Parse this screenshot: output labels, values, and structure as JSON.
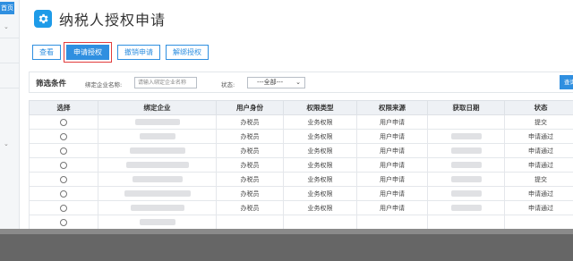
{
  "sidebar": {
    "active_label": "首页"
  },
  "header": {
    "title": "纳税人授权申请"
  },
  "toolbar": {
    "view": "查看",
    "apply": "申请授权",
    "revoke": "撤销申请",
    "unbind": "解绑授权"
  },
  "filter": {
    "title": "筛选条件",
    "company_label": "绑定企业名称:",
    "company_placeholder": "请输入绑定企业名称",
    "status_label": "状态:",
    "status_value": "---全部---",
    "search_label": "查询"
  },
  "table": {
    "columns": [
      "选择",
      "绑定企业",
      "用户身份",
      "权限类型",
      "权限来源",
      "获取日期",
      "状态"
    ],
    "rows": [
      {
        "role": "办税员",
        "perm_type": "业务权限",
        "source": "用户申请",
        "status": "提交"
      },
      {
        "role": "办税员",
        "perm_type": "业务权限",
        "source": "用户申请",
        "status": "申请通过"
      },
      {
        "role": "办税员",
        "perm_type": "业务权限",
        "source": "用户申请",
        "status": "申请通过"
      },
      {
        "role": "办税员",
        "perm_type": "业务权限",
        "source": "用户申请",
        "status": "申请通过"
      },
      {
        "role": "办税员",
        "perm_type": "业务权限",
        "source": "用户申请",
        "status": "提交"
      },
      {
        "role": "办税员",
        "perm_type": "业务权限",
        "source": "用户申请",
        "status": "申请通过"
      },
      {
        "role": "办税员",
        "perm_type": "业务权限",
        "source": "用户申请",
        "status": "申请通过"
      },
      {
        "role": "",
        "perm_type": "",
        "source": "",
        "status": ""
      }
    ]
  },
  "colors": {
    "accent": "#2f8fe0",
    "highlight": "#e23c3c"
  },
  "icons": {
    "title": "gear-icon"
  }
}
